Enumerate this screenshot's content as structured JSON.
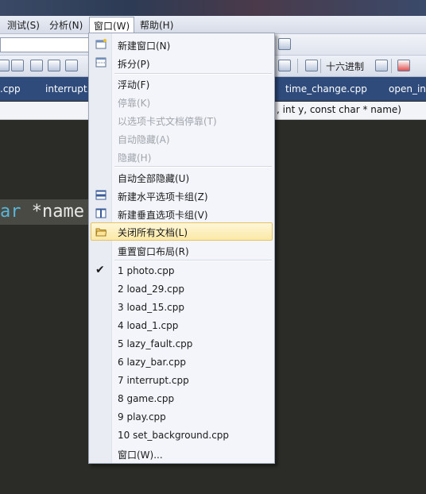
{
  "menubar": {
    "items": [
      "测试(S)",
      "分析(N)",
      "窗口(W)",
      "帮助(H)"
    ]
  },
  "toolbar": {
    "hex_label": "十六进制"
  },
  "tabs": [
    ".cpp",
    "interrupt.",
    "time_change.cpp",
    "open_in"
  ],
  "signature": ", int y, const char * name)",
  "code": {
    "keyword": "ar",
    "identifier": " *name"
  },
  "window_menu": {
    "items": [
      {
        "label": "新建窗口(N)",
        "icon": "new-window-icon",
        "enabled": true
      },
      {
        "label": "拆分(P)",
        "icon": "split-icon",
        "enabled": true
      },
      {
        "label": "浮动(F)",
        "enabled": true
      },
      {
        "label": "停靠(K)",
        "enabled": false
      },
      {
        "label": "以选项卡式文档停靠(T)",
        "enabled": false
      },
      {
        "label": "自动隐藏(A)",
        "enabled": false
      },
      {
        "label": "隐藏(H)",
        "enabled": false
      },
      {
        "label": "自动全部隐藏(U)",
        "enabled": true
      },
      {
        "label": "新建水平选项卡组(Z)",
        "icon": "horizontal-tab-group-icon",
        "enabled": true
      },
      {
        "label": "新建垂直选项卡组(V)",
        "icon": "vertical-tab-group-icon",
        "enabled": true
      },
      {
        "label": "关闭所有文档(L)",
        "icon": "close-all-documents-icon",
        "enabled": true,
        "highlighted": true
      },
      {
        "label": "重置窗口布局(R)",
        "enabled": true
      },
      {
        "label": "1 photo.cpp",
        "checked": true
      },
      {
        "label": "2 load_29.cpp"
      },
      {
        "label": "3 load_15.cpp"
      },
      {
        "label": "4 load_1.cpp"
      },
      {
        "label": "5 lazy_fault.cpp"
      },
      {
        "label": "6 lazy_bar.cpp"
      },
      {
        "label": "7 interrupt.cpp"
      },
      {
        "label": "8 game.cpp"
      },
      {
        "label": "9 play.cpp"
      },
      {
        "label": "10 set_background.cpp"
      },
      {
        "label": "窗口(W)..."
      }
    ]
  }
}
